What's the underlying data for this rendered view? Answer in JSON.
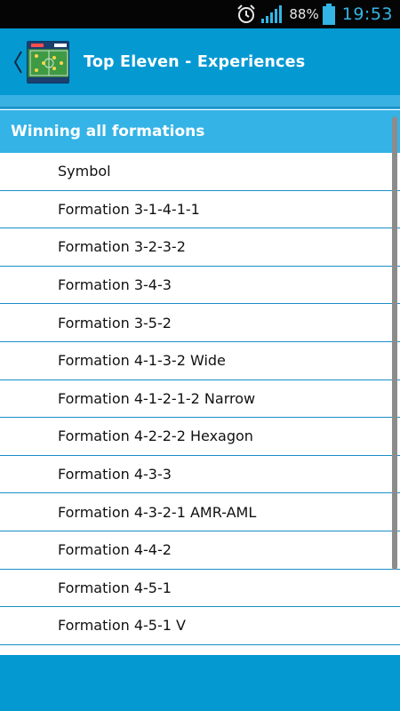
{
  "status_bar": {
    "battery_percent": "88%",
    "time": "19:53",
    "icons": [
      "alarm-clock-icon",
      "signal-strength-icon",
      "battery-icon"
    ],
    "clock_color": "#33b5e5"
  },
  "action_bar": {
    "title": "Top Eleven - Experiences",
    "icons": [
      "up-caret-icon",
      "app-logo-icon"
    ],
    "color": "#0599d2"
  },
  "section": {
    "header": "Winning all formations",
    "color": "#34b3e6"
  },
  "items": [
    "Symbol",
    "Formation 3-1-4-1-1",
    "Formation 3-2-3-2",
    "Formation 3-4-3",
    "Formation 3-5-2",
    "Formation 4-1-3-2 Wide",
    "Formation 4-1-2-1-2 Narrow",
    "Formation 4-2-2-2 Hexagon",
    "Formation 4-3-3",
    "Formation 4-3-2-1 AMR-AML",
    "Formation 4-4-2",
    "Formation 4-5-1",
    "Formation 4-5-1 V"
  ]
}
